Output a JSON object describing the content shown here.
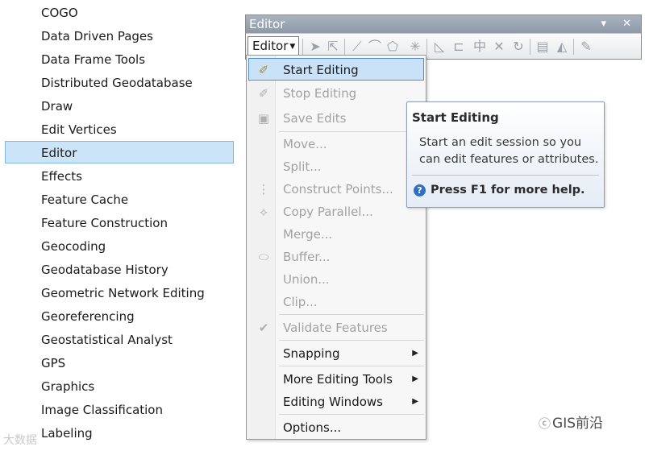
{
  "toolbars_list": {
    "items": [
      {
        "label": "COGO"
      },
      {
        "label": "Data Driven Pages"
      },
      {
        "label": "Data Frame Tools"
      },
      {
        "label": "Distributed Geodatabase"
      },
      {
        "label": "Draw"
      },
      {
        "label": "Edit Vertices"
      },
      {
        "label": "Editor",
        "selected": true
      },
      {
        "label": "Effects"
      },
      {
        "label": "Feature Cache"
      },
      {
        "label": "Feature Construction"
      },
      {
        "label": "Geocoding"
      },
      {
        "label": "Geodatabase History"
      },
      {
        "label": "Geometric Network Editing"
      },
      {
        "label": "Georeferencing"
      },
      {
        "label": "Geostatistical Analyst"
      },
      {
        "label": "GPS"
      },
      {
        "label": "Graphics"
      },
      {
        "label": "Image Classification"
      },
      {
        "label": "Labeling"
      }
    ]
  },
  "editor_window": {
    "title": "Editor",
    "title_buttons": "▾ ✕",
    "menu_button_label": "Editor",
    "toolbar_icons": [
      "edit-tool-icon",
      "edit-annotation-icon",
      "straight-segment-icon",
      "end-point-arc-icon",
      "trace-icon",
      "point-icon",
      "edit-vertices-icon",
      "reshape-icon",
      "cut-polygons-icon",
      "split-tool-icon",
      "rotate-icon",
      "attributes-icon",
      "sketch-properties-icon",
      "create-features-icon"
    ]
  },
  "editor_menu": {
    "items": [
      {
        "label": "Start Editing",
        "enabled": true,
        "highlighted": true,
        "icon": "start-editing-icon"
      },
      {
        "label": "Stop Editing",
        "enabled": false,
        "icon": "stop-editing-icon"
      },
      {
        "label": "Save Edits",
        "enabled": false,
        "icon": "save-icon"
      },
      {
        "label": "Move...",
        "enabled": false
      },
      {
        "label": "Split...",
        "enabled": false
      },
      {
        "label": "Construct Points...",
        "enabled": false,
        "icon": "construct-points-icon"
      },
      {
        "label": "Copy Parallel...",
        "enabled": false,
        "icon": "copy-parallel-icon"
      },
      {
        "label": "Merge...",
        "enabled": false
      },
      {
        "label": "Buffer...",
        "enabled": false,
        "icon": "buffer-icon"
      },
      {
        "label": "Union...",
        "enabled": false
      },
      {
        "label": "Clip...",
        "enabled": false
      },
      {
        "label": "Validate Features",
        "enabled": false,
        "icon": "validate-icon"
      },
      {
        "label": "Snapping",
        "enabled": true,
        "submenu": true
      },
      {
        "label": "More Editing Tools",
        "enabled": true,
        "submenu": true
      },
      {
        "label": "Editing Windows",
        "enabled": true,
        "submenu": true
      },
      {
        "label": "Options...",
        "enabled": true
      }
    ]
  },
  "tooltip": {
    "title": "Start Editing",
    "body": "Start an edit session so you can edit features or attributes.",
    "help": "Press F1 for more help."
  },
  "watermark": {
    "right": "GIS前沿",
    "left": "大数据"
  }
}
